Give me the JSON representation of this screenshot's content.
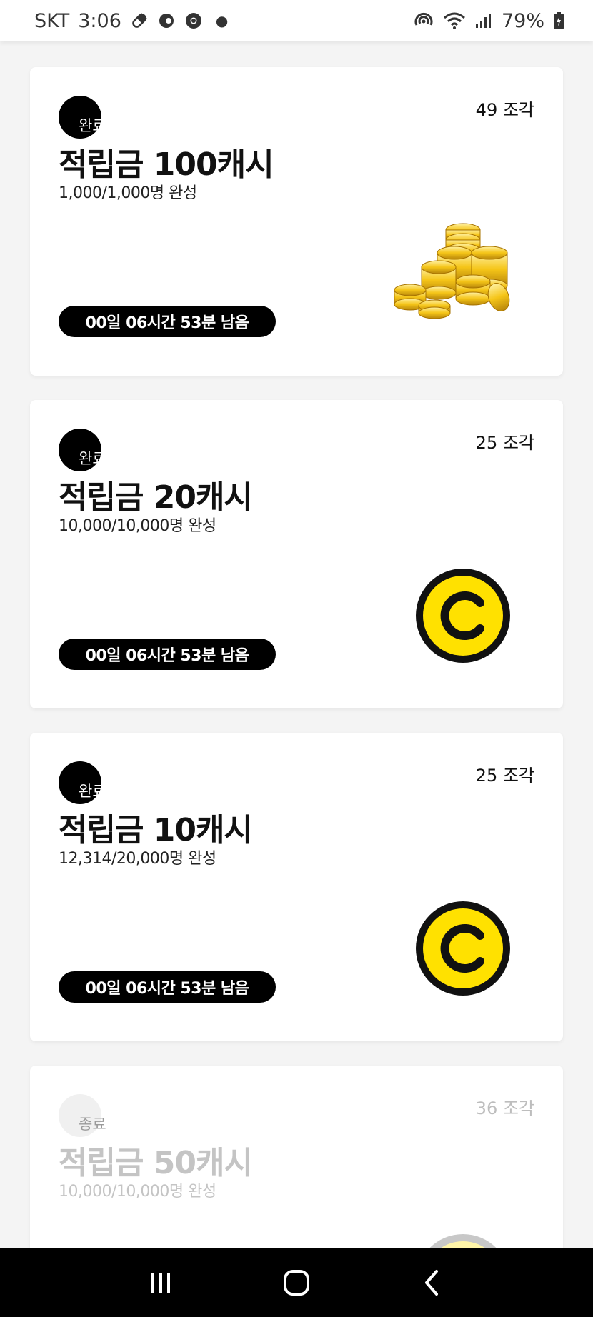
{
  "status_bar": {
    "carrier": "SKT",
    "time": "3:06",
    "battery": "79%",
    "icons": [
      "pill-icon",
      "c-app-icon",
      "chrome-icon",
      "dot-icon",
      "hotspot-icon",
      "wifi-icon",
      "signal-icon",
      "battery-icon"
    ]
  },
  "cards": [
    {
      "badge": "완료",
      "title": "적립금 100캐시",
      "progress": "1,000/1,000명 완성",
      "pieces": "49 조각",
      "timer": "00일 06시간 53분 남음",
      "image": "gold-coins-image",
      "state": "completed"
    },
    {
      "badge": "완료",
      "title": "적립금 20캐시",
      "progress": "10,000/10,000명 완성",
      "pieces": "25 조각",
      "timer": "00일 06시간 53분 남음",
      "image": "cash-coin-icon",
      "state": "completed"
    },
    {
      "badge": "완료",
      "title": "적립금 10캐시",
      "progress": "12,314/20,000명 완성",
      "pieces": "25 조각",
      "timer": "00일 06시간 53분 남음",
      "image": "cash-coin-icon",
      "state": "completed"
    },
    {
      "badge": "종료",
      "title": "적립금 50캐시",
      "progress": "10,000/10,000명 완성",
      "pieces": "36 조각",
      "image": "cash-coin-icon",
      "state": "ended"
    }
  ],
  "nav_bar": {
    "buttons": [
      "recent-apps-icon",
      "home-icon",
      "back-icon"
    ]
  },
  "colors": {
    "coin_yellow": "#FFE100",
    "coin_ring": "#111111",
    "background": "#F4F4F4",
    "timer_bg": "#000000"
  }
}
